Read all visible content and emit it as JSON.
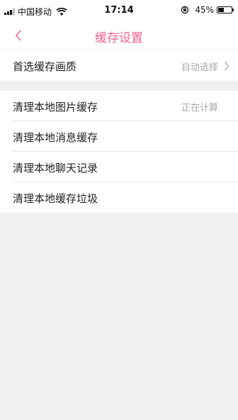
{
  "status": {
    "carrier": "中国移动",
    "time": "17:14",
    "battery_pct": "45%",
    "battery_level": 0.45
  },
  "nav": {
    "title": "缓存设置",
    "back_icon": "chevron-left-icon",
    "accent": "#f06292"
  },
  "settings": {
    "quality": {
      "label": "首选缓存画质",
      "value": "自动选择"
    },
    "clear_images": {
      "label": "清理本地图片缓存",
      "value": "正在计算"
    },
    "clear_messages": {
      "label": "清理本地消息缓存"
    },
    "clear_chat": {
      "label": "清理本地聊天记录"
    },
    "clear_junk": {
      "label": "清理本地缓存垃圾"
    }
  }
}
